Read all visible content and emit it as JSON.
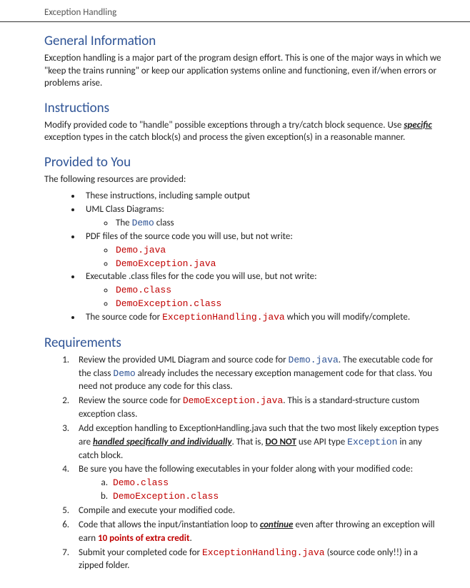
{
  "title": "Exception Handling",
  "sections": {
    "general": {
      "heading": "General Information",
      "text": "Exception handling is a major part of the program design effort. This is one of the major ways in which we \"keep the trains running\" or keep our application systems online and functioning, even if/when errors or problems arise."
    },
    "instructions": {
      "heading": "Instructions",
      "text_before": "Modify provided code to \"handle\" possible exceptions through a try/catch block sequence. Use ",
      "specific": "specific",
      "text_after": " exception types in the catch block(s) and process the given exception(s) in a reasonable manner."
    },
    "provided": {
      "heading": "Provided to You",
      "intro": "The following resources are provided:",
      "items": {
        "item1": "These instructions, including sample output",
        "item2": "UML Class Diagrams:",
        "item2_sub1_a": "The ",
        "item2_sub1_b": "Demo",
        "item2_sub1_c": " class",
        "item3": "PDF files of the source code you will use, but not write:",
        "item3_sub1": "Demo.java",
        "item3_sub2": "DemoException.java",
        "item4": "Executable .class files for the code you will use, but not write:",
        "item4_sub1": "Demo.class",
        "item4_sub2": "DemoException.class",
        "item5_a": "The source code for ",
        "item5_b": "ExceptionHandling.java",
        "item5_c": " which you will modify/complete."
      }
    },
    "requirements": {
      "heading": "Requirements",
      "items": {
        "r1_a": "Review the provided UML Diagram and source code for ",
        "r1_b": "Demo.java",
        "r1_c": ". The executable code for the class ",
        "r1_d": "Demo",
        "r1_e": " already includes the necessary exception management code for that class. You need not produce any code for this class.",
        "r2_a": "Review the source code for ",
        "r2_b": "DemoException.java",
        "r2_c": ". This is a standard-structure custom exception class.",
        "r3_a": "Add exception handling to ExceptionHandling.java such that the two most likely exception types are ",
        "r3_b": "handled specifically and individually",
        "r3_c": ". That is, ",
        "r3_d": "DO NOT",
        "r3_e": " use API type ",
        "r3_f": "Exception",
        "r3_g": " in any catch block.",
        "r4": "Be sure you have the following executables in your folder along with your modified code:",
        "r4_a": "Demo.class",
        "r4_b": "DemoException.class",
        "r5": "Compile and execute your modified code.",
        "r6_a": "Code that allows the input/instantiation loop to ",
        "r6_b": "continue",
        "r6_c": " even after throwing an exception will earn ",
        "r6_d": "10 points of extra credit",
        "r6_e": ".",
        "r7_a": "Submit your completed code for ",
        "r7_b": "ExceptionHandling.java",
        "r7_c": " (source code only!!) in a zipped folder."
      }
    }
  }
}
